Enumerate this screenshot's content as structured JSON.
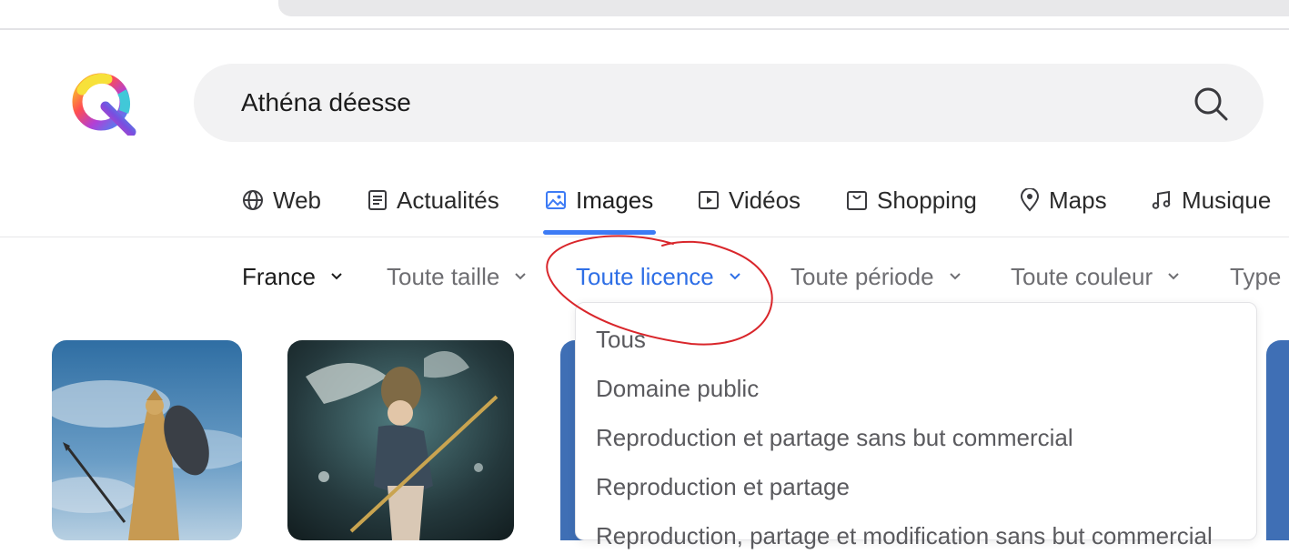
{
  "search": {
    "query": "Athéna déesse"
  },
  "tabs": [
    {
      "label": "Web",
      "icon": "globe-icon"
    },
    {
      "label": "Actualités",
      "icon": "news-icon"
    },
    {
      "label": "Images",
      "icon": "image-icon",
      "active": true
    },
    {
      "label": "Vidéos",
      "icon": "video-icon"
    },
    {
      "label": "Shopping",
      "icon": "shopping-bag-icon"
    },
    {
      "label": "Maps",
      "icon": "map-pin-icon"
    },
    {
      "label": "Musique",
      "icon": "music-note-icon"
    }
  ],
  "filters": [
    {
      "label": "France"
    },
    {
      "label": "Toute taille"
    },
    {
      "label": "Toute licence",
      "active": true
    },
    {
      "label": "Toute période"
    },
    {
      "label": "Toute couleur"
    },
    {
      "label": "Type"
    }
  ],
  "license_menu": {
    "items": [
      "Tous",
      "Domaine public",
      "Reproduction et partage sans but commercial",
      "Reproduction et partage",
      "Reproduction, partage et modification sans but commercial"
    ]
  },
  "colors": {
    "accent": "#3d7bf5",
    "active_filter": "#2f6fe6",
    "annotation": "#d9262b",
    "search_bg": "#f2f2f3"
  }
}
